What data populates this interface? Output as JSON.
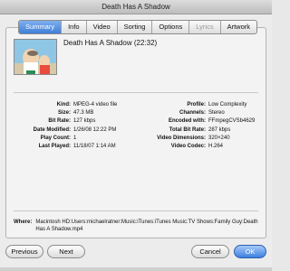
{
  "window": {
    "title": "Death Has A Shadow"
  },
  "tabs": [
    {
      "label": "Summary",
      "selected": true,
      "disabled": false
    },
    {
      "label": "Info",
      "selected": false,
      "disabled": false
    },
    {
      "label": "Video",
      "selected": false,
      "disabled": false
    },
    {
      "label": "Sorting",
      "selected": false,
      "disabled": false
    },
    {
      "label": "Options",
      "selected": false,
      "disabled": false
    },
    {
      "label": "Lyrics",
      "selected": false,
      "disabled": true
    },
    {
      "label": "Artwork",
      "selected": false,
      "disabled": false
    }
  ],
  "header": {
    "title": "Death Has A Shadow (22:32)"
  },
  "details_left": [
    {
      "label": "Kind:",
      "value": "MPEG-4 video file"
    },
    {
      "label": "Size:",
      "value": "47.3 MB"
    },
    {
      "label": "Bit Rate:",
      "value": "127 kbps"
    },
    {
      "label": "Date Modified:",
      "value": "1/26/08 12:22 PM"
    },
    {
      "label": "Play Count:",
      "value": "1"
    },
    {
      "label": "Last Played:",
      "value": "11/18/07 1:14 AM"
    }
  ],
  "details_right": [
    {
      "label": "Profile:",
      "value": "Low Complexity"
    },
    {
      "label": "Channels:",
      "value": "Stereo"
    },
    {
      "label": "Encoded with:",
      "value": "FFmpegCVSb4629"
    },
    {
      "label": "Total Bit Rate:",
      "value": "287 kbps"
    },
    {
      "label": "Video Dimensions:",
      "value": "320×240"
    },
    {
      "label": "Video Codec:",
      "value": "H.264"
    }
  ],
  "where": {
    "label": "Where:",
    "value": "Macintosh HD:Users:michaelratner:Music:iTunes:iTunes Music:TV Shows:Family Guy:Death Has A Shadow.mp4"
  },
  "buttons": {
    "previous": "Previous",
    "next": "Next",
    "cancel": "Cancel",
    "ok": "OK"
  },
  "colors": {
    "selected_tab": "#3f7fd9",
    "ok_button": "#3d7fe0"
  },
  "icons": {
    "artwork": "artwork-thumbnail"
  }
}
